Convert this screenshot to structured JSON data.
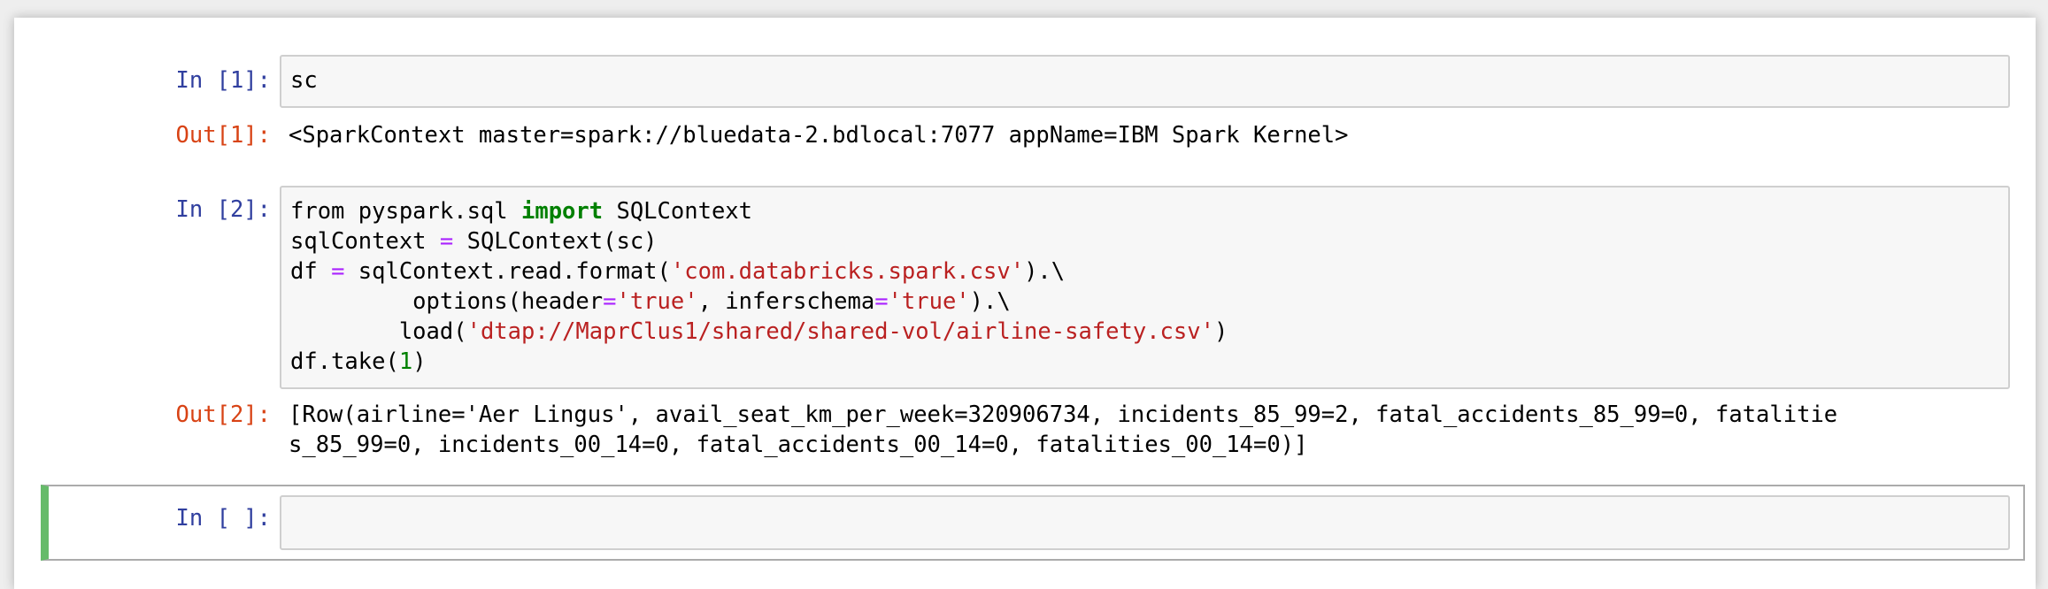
{
  "colors": {
    "prompt_in": "#303f9f",
    "prompt_out": "#d84315",
    "keyword": "#008000",
    "operator": "#aa22ff",
    "string": "#ba2121",
    "selected_border": "#66bb6a"
  },
  "cells": [
    {
      "in_prompt": "In [1]:",
      "code_lines": [
        "sc"
      ],
      "out_prompt": "Out[1]:",
      "output_lines": [
        "<SparkContext master=spark://bluedata-2.bdlocal:7077 appName=IBM Spark Kernel>"
      ]
    },
    {
      "in_prompt": "In [2]:",
      "code": {
        "l1_a": "from pyspark.sql ",
        "l1_kw": "import",
        "l1_b": " SQLContext",
        "l2_a": "sqlContext ",
        "l2_op": "=",
        "l2_b": " SQLContext(sc)",
        "l3_a": "df ",
        "l3_op": "=",
        "l3_b": " sqlContext.read.format(",
        "l3_str": "'com.databricks.spark.csv'",
        "l3_c": ").\\",
        "l4_a": "         options(header",
        "l4_op1": "=",
        "l4_str1": "'true'",
        "l4_b": ", inferschema",
        "l4_op2": "=",
        "l4_str2": "'true'",
        "l4_c": ").\\",
        "l5_a": "        load(",
        "l5_str": "'dtap://MaprClus1/shared/shared-vol/airline-safety.csv'",
        "l5_b": ")",
        "l6_a": "df.take(",
        "l6_num": "1",
        "l6_b": ")"
      },
      "out_prompt": "Out[2]:",
      "output_lines": [
        "[Row(airline='Aer Lingus', avail_seat_km_per_week=320906734, incidents_85_99=2, fatal_accidents_85_99=0, fatalitie",
        "s_85_99=0, incidents_00_14=0, fatal_accidents_00_14=0, fatalities_00_14=0)]"
      ]
    },
    {
      "in_prompt": "In [ ]:",
      "code_lines": [
        ""
      ]
    }
  ]
}
